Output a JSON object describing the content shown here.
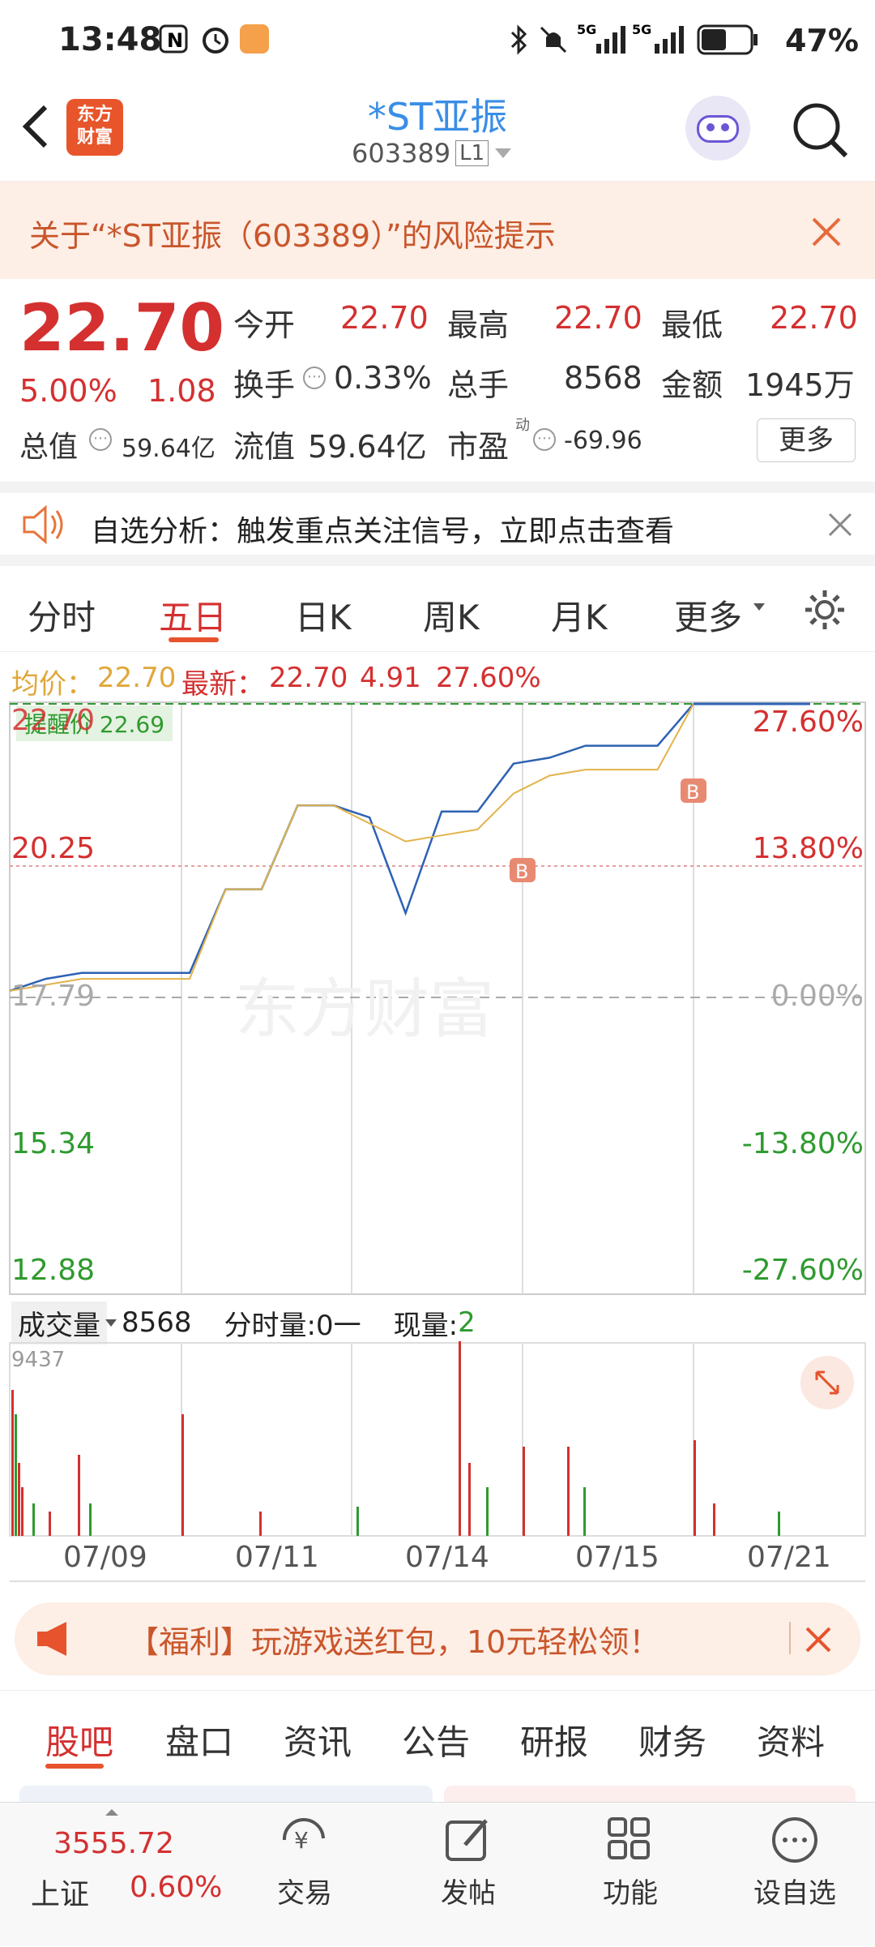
{
  "status_bar": {
    "time": "13:48",
    "battery": "47%"
  },
  "nav": {
    "app_logo": "东方\n财富",
    "stock_name": "*ST亚振",
    "stock_code": "603389",
    "level_badge": "L1"
  },
  "risk_banner": {
    "text": "关于“*ST亚振（603389）”的风险提示"
  },
  "quote": {
    "price": "22.70",
    "change_pct": "5.00%",
    "change": "1.08",
    "open_label": "今开",
    "open": "22.70",
    "high_label": "最高",
    "high": "22.70",
    "low_label": "最低",
    "low": "22.70",
    "turnover_label": "换手",
    "turnover": "0.33%",
    "volume_label": "总手",
    "volume": "8568",
    "amount_label": "金额",
    "amount": "1945万",
    "mktcap_label": "总值",
    "mktcap": "59.64亿",
    "float_label": "流值",
    "float_cap": "59.64亿",
    "pe_label": "市盈",
    "pe_sup": "动",
    "pe": "-69.96",
    "more_button": "更多"
  },
  "alert": {
    "text": "自选分析：触发重点关注信号，立即点击查看"
  },
  "chart_tabs": [
    "分时",
    "五日",
    "日K",
    "周K",
    "月K",
    "更多"
  ],
  "active_tab": "五日",
  "avg_line": {
    "avg_label": "均价：",
    "avg": "22.70",
    "latest_label": "最新：",
    "latest": "22.70",
    "chg": "4.91",
    "pct": "27.60%"
  },
  "chart_data": {
    "type": "line",
    "title": "",
    "y_left_ticks": [
      "22.70",
      "20.25",
      "17.79",
      "15.34",
      "12.88"
    ],
    "y_right_ticks": [
      "27.60%",
      "13.80%",
      "0.00%",
      "-13.80%",
      "-27.60%"
    ],
    "x_labels": [
      "07/09",
      "07/11",
      "07/14",
      "07/15",
      "07/21"
    ],
    "reminder_label": "提醒价 22.69",
    "series": [
      {
        "values": [
          17.9,
          18.1,
          18.2,
          18.2,
          18.2,
          18.2,
          19.6,
          19.6,
          21.0,
          21.0,
          20.8,
          19.2,
          20.9,
          20.9,
          21.7,
          21.8,
          22.0,
          22.0,
          22.0,
          22.7
        ]
      },
      {
        "values": [
          17.9,
          18.0,
          18.1,
          18.1,
          18.1,
          18.1,
          19.6,
          19.6,
          21.0,
          21.0,
          20.7,
          20.4,
          20.5,
          20.6,
          21.2,
          21.5,
          21.6,
          21.6,
          21.6,
          22.7
        ]
      }
    ],
    "volume": {
      "label": "成交量",
      "value": "8568",
      "intraday_label": "分时量:0一",
      "current_label": "现量:",
      "current": "2",
      "max": "9437"
    }
  },
  "ad": {
    "text": "【福利】玩游戏送红包，10元轻松领！"
  },
  "bottom_tabs": [
    "股吧",
    "盘口",
    "资讯",
    "公告",
    "研报",
    "财务",
    "资料"
  ],
  "footer": {
    "index_value": "3555.72",
    "index_name": "上证",
    "index_pct": "0.60%",
    "items": [
      "交易",
      "发帖",
      "功能",
      "设自选"
    ]
  }
}
